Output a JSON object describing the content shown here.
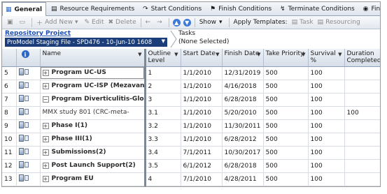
{
  "tabs": [
    {
      "label": "General",
      "icon": "general-icon",
      "active": true
    },
    {
      "label": "Resource Requirements",
      "icon": "resource-requirements-icon"
    },
    {
      "label": "Start Conditions",
      "icon": "start-conditions-icon"
    },
    {
      "label": "Finish Conditions",
      "icon": "finish-conditions-icon"
    },
    {
      "label": "Terminate Conditions",
      "icon": "terminate-conditions-icon"
    },
    {
      "label": "Financ",
      "icon": "financials-icon"
    }
  ],
  "toolbar": {
    "add_new": "Add New",
    "edit": "Edit",
    "delete": "Delete",
    "show": "Show",
    "apply_templates": "Apply Templates:",
    "task": "Task",
    "resourcing": "Resourcing"
  },
  "repository": {
    "link": "Repository Project",
    "selected": "ProModel Staging File - SPD476 - 10-Jun-10 1608"
  },
  "tasks": {
    "label": "Tasks",
    "value": "(None Selected)"
  },
  "columns": {
    "name": "Name",
    "outline": "Outline Level",
    "start": "Start Date",
    "finish": "Finish Date",
    "priority": "Take Priority",
    "survival": "Survival %",
    "duration": "Duration Completed"
  },
  "rows": [
    {
      "idx": "5",
      "name": "Program UC-US",
      "level": 0,
      "expander": "+",
      "bold": true,
      "outline": "1",
      "start": "1/1/2010",
      "finish": "12/31/2019",
      "priority": "500",
      "survival": "100",
      "duration": ""
    },
    {
      "idx": "6",
      "name": "Program UC-ISP (Mezavant)",
      "level": 0,
      "expander": "+",
      "bold": true,
      "outline": "2",
      "start": "1/1/2010",
      "finish": "4/16/2018",
      "priority": "500",
      "survival": "100",
      "duration": ""
    },
    {
      "idx": "7",
      "name": "Program Diverticulitis-Globa",
      "level": 0,
      "expander": "−",
      "bold": true,
      "outline": "3",
      "start": "1/1/2010",
      "finish": "6/28/2018",
      "priority": "500",
      "survival": "100",
      "duration": ""
    },
    {
      "idx": "8",
      "name": "MMX study 801 (CRC-meta-",
      "level": 2,
      "expander": "",
      "bold": false,
      "outline": "3.1",
      "start": "1/1/2010",
      "finish": "5/20/2010",
      "priority": "500",
      "survival": "100",
      "duration": "100"
    },
    {
      "idx": "9",
      "name": "Phase I(1)",
      "level": 1,
      "expander": "+",
      "bold": true,
      "outline": "3.2",
      "start": "1/1/2010",
      "finish": "11/30/2011",
      "priority": "500",
      "survival": "100",
      "duration": ""
    },
    {
      "idx": "10",
      "name": "Phase III(1)",
      "level": 1,
      "expander": "+",
      "bold": true,
      "outline": "3.3",
      "start": "1/1/2010",
      "finish": "6/28/2012",
      "priority": "500",
      "survival": "100",
      "duration": ""
    },
    {
      "idx": "11",
      "name": "Submissions(2)",
      "level": 1,
      "expander": "+",
      "bold": true,
      "outline": "3.4",
      "start": "7/1/2011",
      "finish": "10/30/2017",
      "priority": "500",
      "survival": "100",
      "duration": ""
    },
    {
      "idx": "12",
      "name": "Post Launch Support(2)",
      "level": 1,
      "expander": "+",
      "bold": true,
      "outline": "3.5",
      "start": "6/1/2012",
      "finish": "6/28/2018",
      "priority": "500",
      "survival": "100",
      "duration": ""
    },
    {
      "idx": "13",
      "name": "Program EU",
      "level": 0,
      "expander": "+",
      "bold": true,
      "outline": "4",
      "start": "7/1/2010",
      "finish": "4/28/2011",
      "priority": "500",
      "survival": "100",
      "duration": ""
    }
  ]
}
